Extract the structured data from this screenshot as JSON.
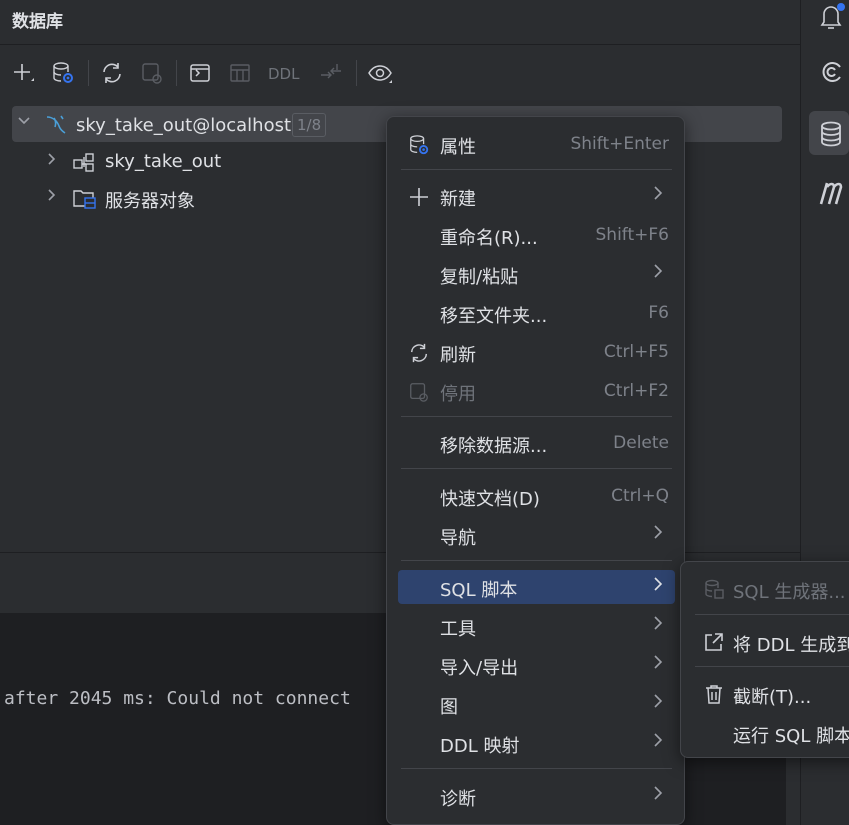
{
  "panel": {
    "title": "数据库",
    "toolbar": {
      "ddl_label": "DDL"
    }
  },
  "tree": {
    "root": {
      "label": "sky_take_out@localhost",
      "badge": "1/8"
    },
    "children": [
      {
        "label": "sky_take_out"
      },
      {
        "label": "服务器对象"
      }
    ]
  },
  "console": {
    "line": "after 2045 ms: Could not connect"
  },
  "context_menu": {
    "items": [
      {
        "label": "属性",
        "shortcut": "Shift+Enter",
        "icon": "database-settings-icon"
      },
      {
        "label": "新建",
        "icon": "plus-icon",
        "submenu": true
      },
      {
        "label": "重命名(R)...",
        "shortcut": "Shift+F6"
      },
      {
        "label": "复制/粘贴",
        "submenu": true
      },
      {
        "label": "移至文件夹...",
        "shortcut": "F6"
      },
      {
        "label": "刷新",
        "shortcut": "Ctrl+F5",
        "icon": "refresh-icon"
      },
      {
        "label": "停用",
        "shortcut": "Ctrl+F2",
        "icon": "disconnect-icon",
        "disabled": true
      },
      {
        "label": "移除数据源...",
        "shortcut": "Delete"
      },
      {
        "label": "快速文档(D)",
        "shortcut": "Ctrl+Q"
      },
      {
        "label": "导航",
        "submenu": true
      },
      {
        "label": "SQL 脚本",
        "submenu": true,
        "active": true
      },
      {
        "label": "工具",
        "submenu": true
      },
      {
        "label": "导入/导出",
        "submenu": true
      },
      {
        "label": "图",
        "submenu": true
      },
      {
        "label": "DDL 映射",
        "submenu": true
      },
      {
        "label": "诊断",
        "submenu": true
      }
    ]
  },
  "sub_menu": {
    "items": [
      {
        "label": "SQL 生成器...",
        "disabled": true,
        "icon": "sql-generator-icon"
      },
      {
        "label": "将 DDL 生成到",
        "icon": "external-link-icon"
      },
      {
        "label": "截断(T)...",
        "icon": "trash-icon"
      },
      {
        "label": "运行 SQL 脚本"
      }
    ]
  },
  "colors": {
    "background": "#2b2d30",
    "console_bg": "#1e1f22",
    "selection": "#2e436e",
    "tree_selection": "#43454a",
    "accent_blue": "#3574f0",
    "mysql_blue": "#4a9fd8"
  }
}
